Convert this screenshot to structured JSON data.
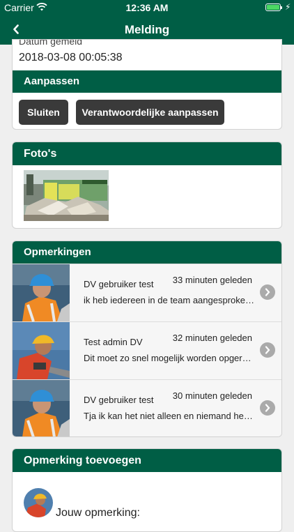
{
  "status_bar": {
    "carrier": "Carrier",
    "time": "12:36 AM",
    "battery_level": 1.0,
    "battery_color": "#4cd964"
  },
  "nav": {
    "title": "Melding",
    "back_icon": "chevron-left-icon"
  },
  "detail": {
    "partial_label": "Datum gemeld",
    "date": "2018-03-08 00:05:38",
    "section_title": "Aanpassen",
    "buttons": {
      "close": "Sluiten",
      "responsible": "Verantwoordelijke aanpassen"
    }
  },
  "photos": {
    "title": "Foto's"
  },
  "comments": {
    "title": "Opmerkingen",
    "items": [
      {
        "user": "DV gebruiker test",
        "when": "33 minuten geleden",
        "text": "ik heb iedereen in de team aangesproken over dit probleem"
      },
      {
        "user": "Test admin DV",
        "when": "32 minuten geleden",
        "text": "Dit moet zo snel mogelijk worden opgeruimd!"
      },
      {
        "user": "DV gebruiker test",
        "when": "30 minuten geleden",
        "text": "Tja ik kan het niet alleen en niemand heeft tijd"
      }
    ]
  },
  "add_comment": {
    "title": "Opmerking toevoegen",
    "label": "Jouw opmerking:"
  },
  "colors": {
    "brand": "#005e45",
    "button": "#3a3a3a",
    "background": "#efefef"
  }
}
